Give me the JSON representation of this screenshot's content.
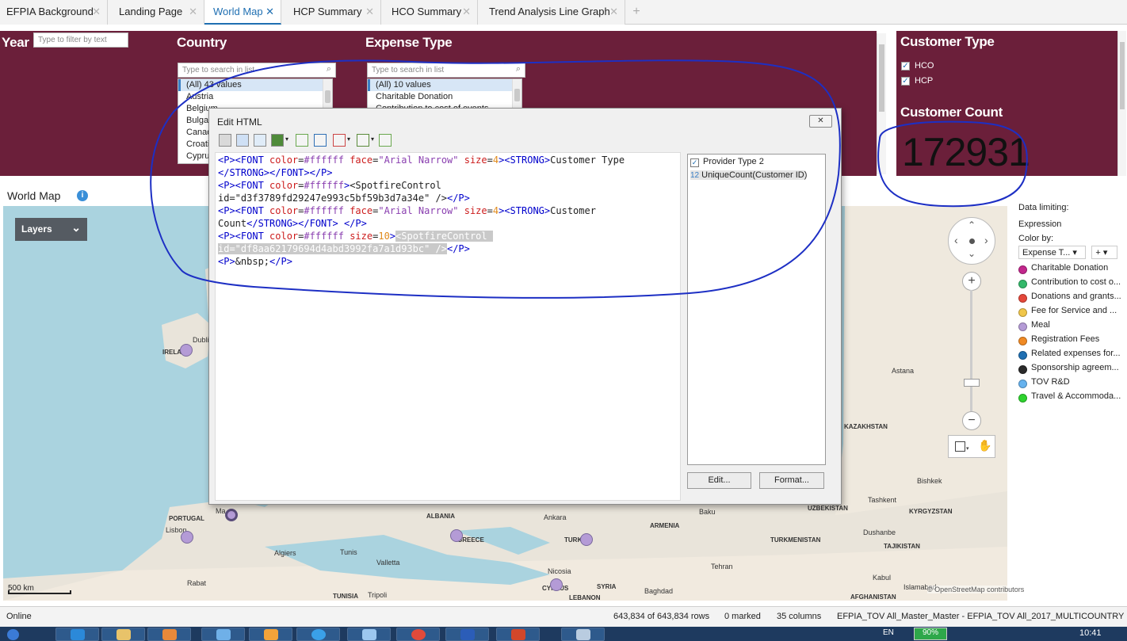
{
  "tabs": [
    {
      "label": "EFPIA Background"
    },
    {
      "label": "Landing Page"
    },
    {
      "label": "World Map"
    },
    {
      "label": "HCP Summary"
    },
    {
      "label": "HCO Summary"
    },
    {
      "label": "Trend Analysis Line Graph"
    }
  ],
  "tab_add": "+",
  "filters": {
    "year_label": "Year",
    "year_placeholder": "Type to filter by text",
    "country_label": "Country",
    "country_placeholder": "Type to search in list",
    "country_items": [
      "(All) 43 values",
      "Austria",
      "Belgium",
      "Bulgaria",
      "Canada",
      "Croatia",
      "Cyprus"
    ],
    "expense_label": "Expense Type",
    "expense_placeholder": "Type to search in list",
    "expense_items": [
      "(All) 10 values",
      "Charitable Donation",
      "Contribution to cost of events"
    ]
  },
  "customer": {
    "type_label": "Customer Type",
    "options": [
      "HCO",
      "HCP"
    ],
    "count_label": "Customer Count",
    "count_value": "172931"
  },
  "map": {
    "title": "World Map",
    "layers_label": "Layers",
    "scale": "500 km",
    "attribution": "© OpenStreetMap contributors",
    "places": [
      "IRELAND",
      "Dublin",
      "PORTUGAL",
      "Lisbon",
      "Ma",
      "ALBANIA",
      "GREECE",
      "TURKEY",
      "Ankara",
      "ARMENIA",
      "Baku",
      "Algiers",
      "Tunis",
      "Valletta",
      "TUNISIA",
      "Tripoli",
      "Nicosia",
      "CYPRUS",
      "SYRIA",
      "LEBANON",
      "Baghdad",
      "Tehran",
      "Rabat",
      "Astana",
      "KAZAKHSTAN",
      "UZBEKISTAN",
      "Tashkent",
      "KYRGYZSTAN",
      "Bishkek",
      "TURKMENISTAN",
      "Dushanbe",
      "TAJIKISTAN",
      "Kabul",
      "Islamabad",
      "AFGHANISTAN"
    ]
  },
  "legend": {
    "data_limiting": "Data limiting:",
    "expression": "Expression",
    "color_by": "Color by:",
    "color_by_value": "Expense T...",
    "add": "+",
    "items": [
      {
        "label": "Charitable Donation",
        "color": "#c2278c"
      },
      {
        "label": "Contribution to cost o...",
        "color": "#33b86a"
      },
      {
        "label": "Donations and grants...",
        "color": "#e4473a"
      },
      {
        "label": "Fee for Service and ...",
        "color": "#f0c64a"
      },
      {
        "label": "Meal",
        "color": "#b49bd6"
      },
      {
        "label": "Registration Fees",
        "color": "#f08a24"
      },
      {
        "label": "Related expenses for...",
        "color": "#1f6fb2"
      },
      {
        "label": "Sponsorship agreem...",
        "color": "#2b2b2b"
      },
      {
        "label": "TOV R&D",
        "color": "#66b2ee"
      },
      {
        "label": "Travel & Accommoda...",
        "color": "#2ed32e"
      }
    ]
  },
  "dialog": {
    "title": "Edit HTML",
    "close": "✕",
    "controls": [
      {
        "label": "Provider Type 2",
        "icon": "checkbox-icon"
      },
      {
        "label": "UniqueCount(Customer ID)",
        "icon": "number-icon",
        "prefix": "12"
      }
    ],
    "edit_button": "Edit...",
    "format_button": "Format..."
  },
  "status": {
    "state": "Online",
    "rows": "643,834 of 643,834 rows",
    "marked": "0 marked",
    "columns": "35 columns",
    "source": "EFPIA_TOV All_Master_Master - EFPIA_TOV All_2017_MULTICOUNTRY"
  },
  "taskbar": {
    "lang": "EN",
    "battery": "90%",
    "time": "10:41"
  },
  "colors": {
    "panel_bg": "#6b1f3a",
    "accent": "#1f6fb2",
    "ink": "#1d2fc4"
  }
}
